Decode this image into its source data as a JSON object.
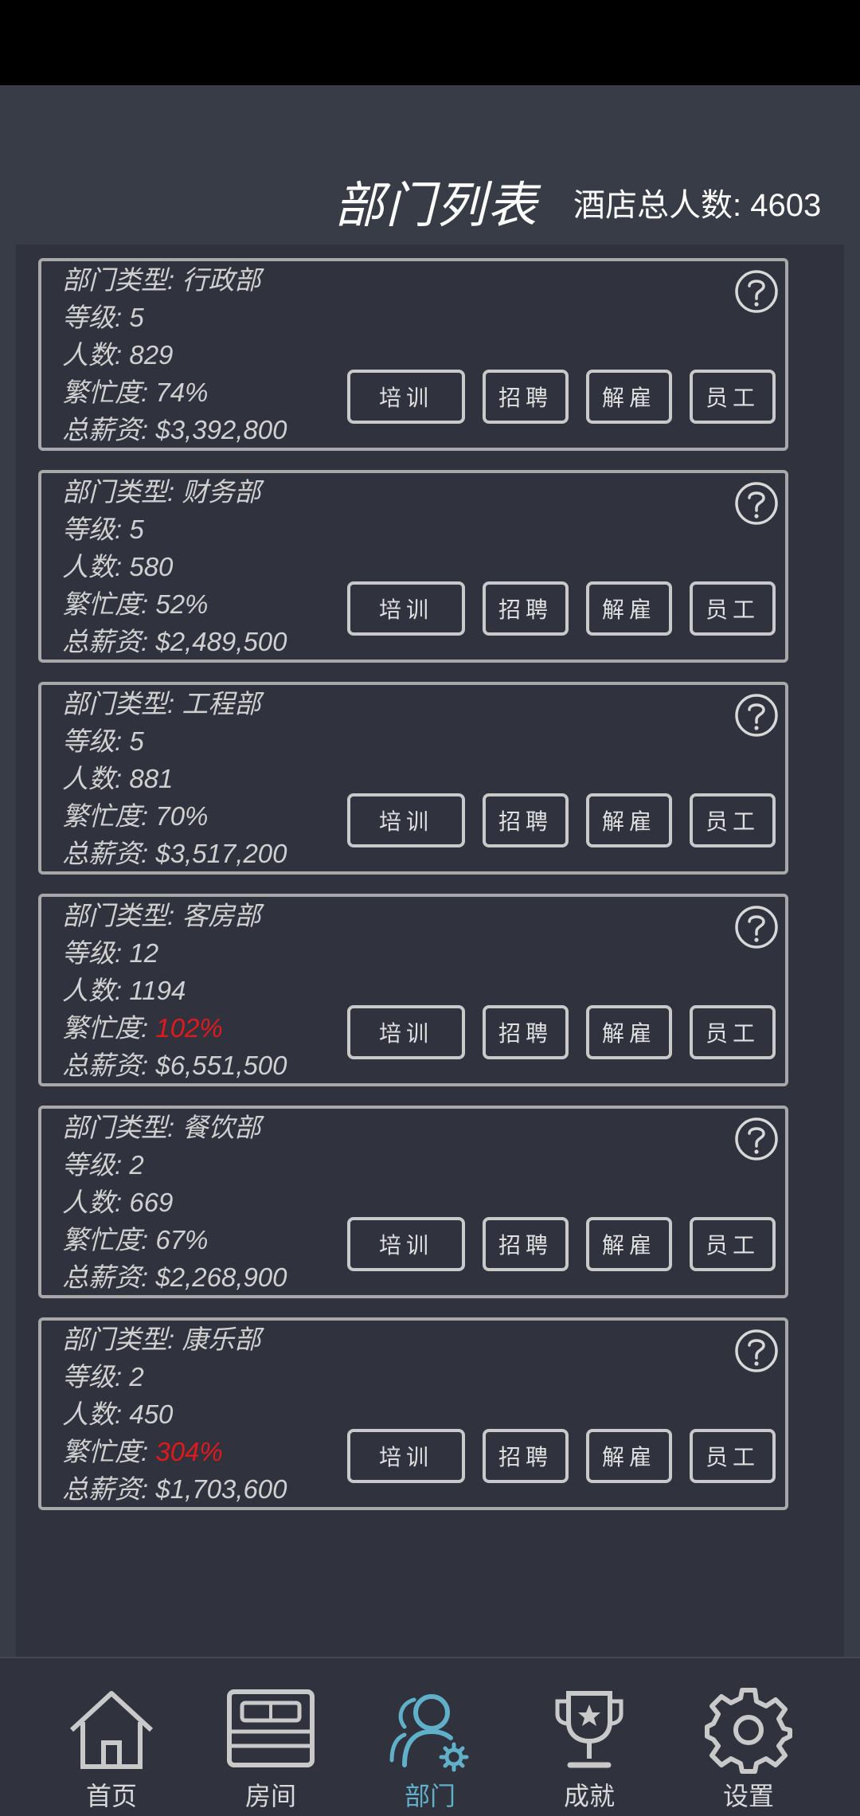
{
  "header": {
    "title": "部门列表",
    "total_label": "酒店总人数: 4603"
  },
  "departments": [
    {
      "type": "部门类型: 行政部",
      "level": "等级: 5",
      "count": "人数: 829",
      "busy_label": "繁忙度: ",
      "busy": "74%",
      "busy_high": false,
      "salary": "总薪资: $3,392,800"
    },
    {
      "type": "部门类型: 财务部",
      "level": "等级: 5",
      "count": "人数: 580",
      "busy_label": "繁忙度: ",
      "busy": "52%",
      "busy_high": false,
      "salary": "总薪资: $2,489,500"
    },
    {
      "type": "部门类型: 工程部",
      "level": "等级: 5",
      "count": "人数: 881",
      "busy_label": "繁忙度: ",
      "busy": "70%",
      "busy_high": false,
      "salary": "总薪资: $3,517,200"
    },
    {
      "type": "部门类型: 客房部",
      "level": "等级: 12",
      "count": "人数: 1194",
      "busy_label": "繁忙度: ",
      "busy": "102%",
      "busy_high": true,
      "salary": "总薪资: $6,551,500"
    },
    {
      "type": "部门类型: 餐饮部",
      "level": "等级: 2",
      "count": "人数: 669",
      "busy_label": "繁忙度: ",
      "busy": "67%",
      "busy_high": false,
      "salary": "总薪资: $2,268,900"
    },
    {
      "type": "部门类型: 康乐部",
      "level": "等级: 2",
      "count": "人数: 450",
      "busy_label": "繁忙度: ",
      "busy": "304%",
      "busy_high": true,
      "salary": "总薪资: $1,703,600"
    }
  ],
  "buttons": {
    "train": "培训",
    "recruit": "招聘",
    "fire": "解雇",
    "staff": "员工"
  },
  "colors": {
    "background": "#383c47",
    "panel": "#30323d",
    "busy_high": "#e0191d",
    "nav_active": "#5fb0c8"
  },
  "nav": [
    {
      "label": "首页",
      "icon": "home-icon",
      "active": false
    },
    {
      "label": "房间",
      "icon": "bed-icon",
      "active": false
    },
    {
      "label": "部门",
      "icon": "department-people-icon",
      "active": true
    },
    {
      "label": "成就",
      "icon": "trophy-icon",
      "active": false
    },
    {
      "label": "设置",
      "icon": "gear-icon",
      "active": false
    }
  ]
}
